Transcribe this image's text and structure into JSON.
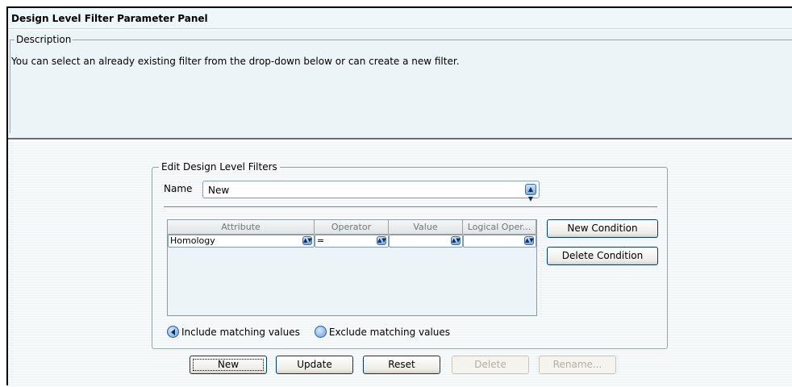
{
  "panel": {
    "title": "Design Level Filter Parameter Panel",
    "description_legend": "Description",
    "description_text": "You can select an already existing filter from the drop-down below or can create a new filter."
  },
  "edit_filters": {
    "legend": "Edit Design Level Filters",
    "name_label": "Name",
    "name_value": "New",
    "table": {
      "columns": [
        "Attribute",
        "Operator",
        "Value",
        "Logical Oper..."
      ],
      "rows": [
        [
          "Homology",
          "=",
          "",
          ""
        ]
      ]
    },
    "new_condition_label": "New Condition",
    "delete_condition_label": "Delete Condition",
    "include_label": "Include matching values",
    "exclude_label": "Exclude matching values",
    "selected_option": "include"
  },
  "actions": {
    "new_label": "New",
    "update_label": "Update",
    "reset_label": "Reset",
    "delete_label": "Delete",
    "rename_label": "Rename..."
  },
  "colors": {
    "title_bg": "#eef8fb",
    "description_bg": "#edf4f8",
    "button_border": "#003c74",
    "radio_blue": "#6aa0e0"
  }
}
